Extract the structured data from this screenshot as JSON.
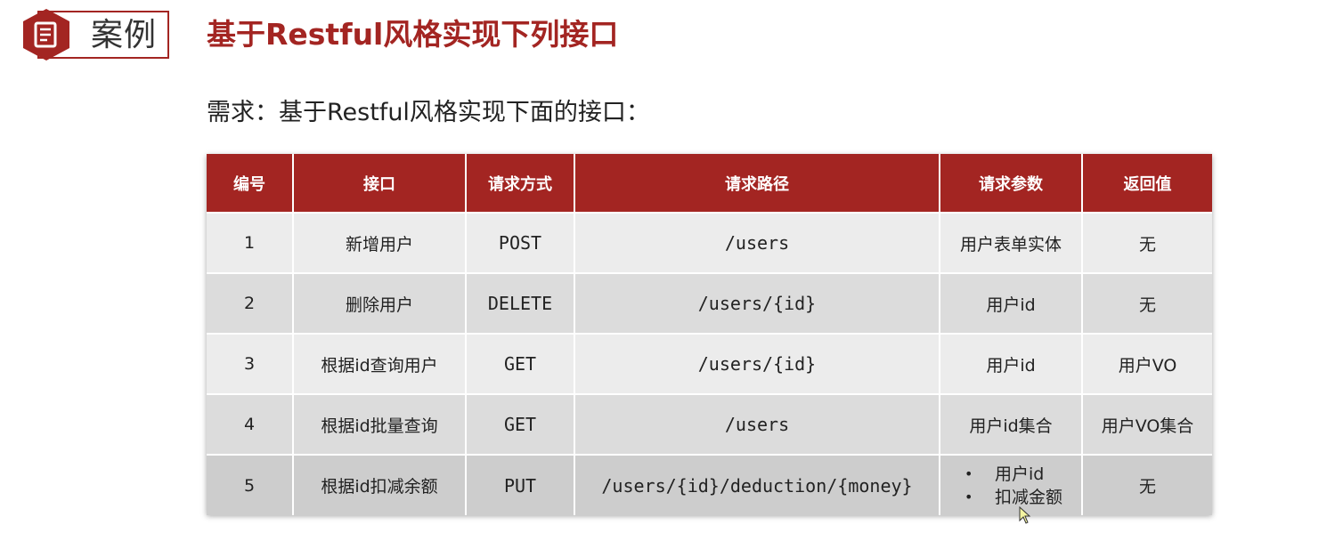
{
  "header": {
    "badge_label": "案例",
    "title": "基于Restful风格实现下列接口"
  },
  "requirement": "需求：基于Restful风格实现下面的接口：",
  "table": {
    "columns": [
      "编号",
      "接口",
      "请求方式",
      "请求路径",
      "请求参数",
      "返回值"
    ],
    "rows": [
      {
        "id": "1",
        "name": "新增用户",
        "method": "POST",
        "path": "/users",
        "params": "用户表单实体",
        "returns": "无"
      },
      {
        "id": "2",
        "name": "删除用户",
        "method": "DELETE",
        "path": "/users/{id}",
        "params": "用户id",
        "returns": "无"
      },
      {
        "id": "3",
        "name": "根据id查询用户",
        "method": "GET",
        "path": "/users/{id}",
        "params": "用户id",
        "returns": "用户VO"
      },
      {
        "id": "4",
        "name": "根据id批量查询",
        "method": "GET",
        "path": "/users",
        "params": "用户id集合",
        "returns": "用户VO集合"
      },
      {
        "id": "5",
        "name": "根据id扣减余额",
        "method": "PUT",
        "path": "/users/{id}/deduction/{money}",
        "params_list": [
          "用户id",
          "扣减金额"
        ],
        "returns": "无"
      }
    ]
  },
  "colors": {
    "accent": "#a32522",
    "header_text": "#ffffff",
    "row_light": "#ececec",
    "row_mid": "#dcdcdc",
    "row_dark": "#cdcdcd"
  },
  "icons": {
    "badge_icon": "document-icon",
    "cursor": "mouse-pointer-icon"
  }
}
